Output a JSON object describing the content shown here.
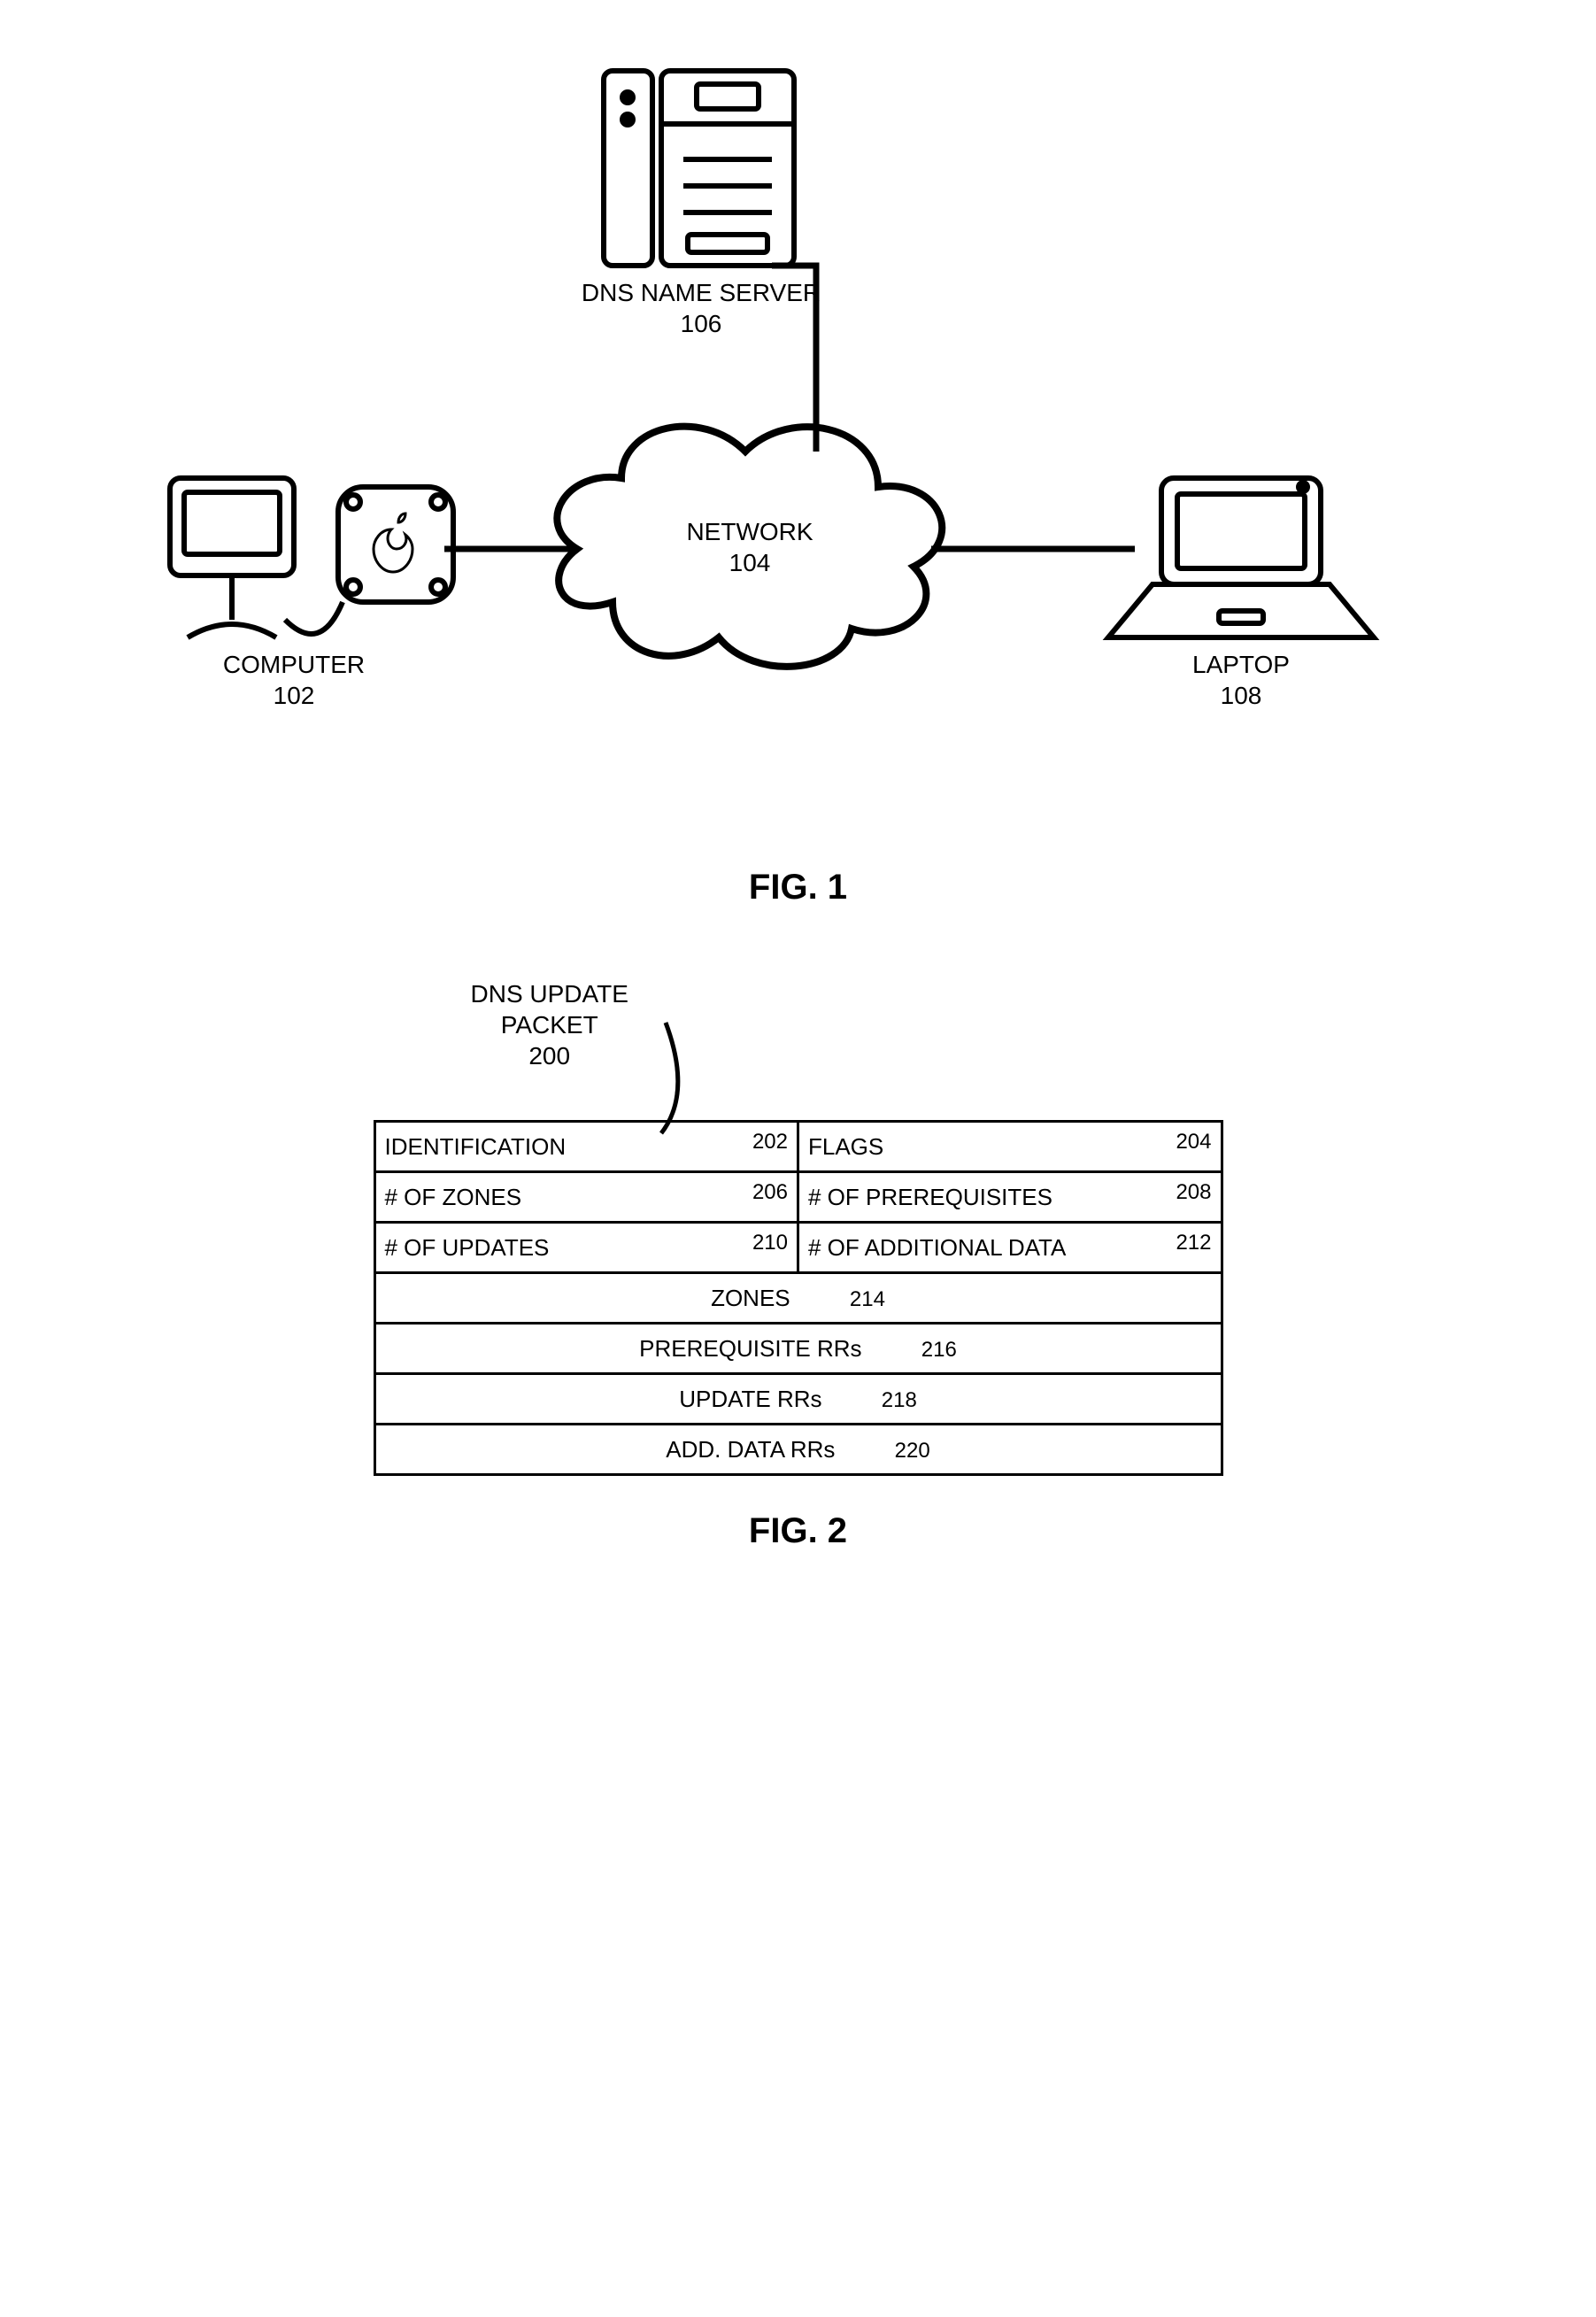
{
  "fig1": {
    "computer_label": "COMPUTER",
    "computer_num": "102",
    "network_label": "NETWORK",
    "network_num": "104",
    "dns_label": "DNS NAME SERVER",
    "dns_num": "106",
    "laptop_label": "LAPTOP",
    "laptop_num": "108",
    "caption": "FIG. 1"
  },
  "fig2": {
    "header_label": "DNS UPDATE\nPACKET",
    "header_num": "200",
    "rows_half": [
      {
        "l": "IDENTIFICATION",
        "ln": "202",
        "r": "FLAGS",
        "rn": "204"
      },
      {
        "l": "# OF ZONES",
        "ln": "206",
        "r": "# OF PREREQUISITES",
        "rn": "208"
      },
      {
        "l": "# OF UPDATES",
        "ln": "210",
        "r": "# OF ADDITIONAL DATA",
        "rn": "212"
      }
    ],
    "rows_full": [
      {
        "l": "ZONES",
        "n": "214"
      },
      {
        "l": "PREREQUISITE RRs",
        "n": "216"
      },
      {
        "l": "UPDATE RRs",
        "n": "218"
      },
      {
        "l": "ADD. DATA RRs",
        "n": "220"
      }
    ],
    "caption": "FIG. 2"
  }
}
